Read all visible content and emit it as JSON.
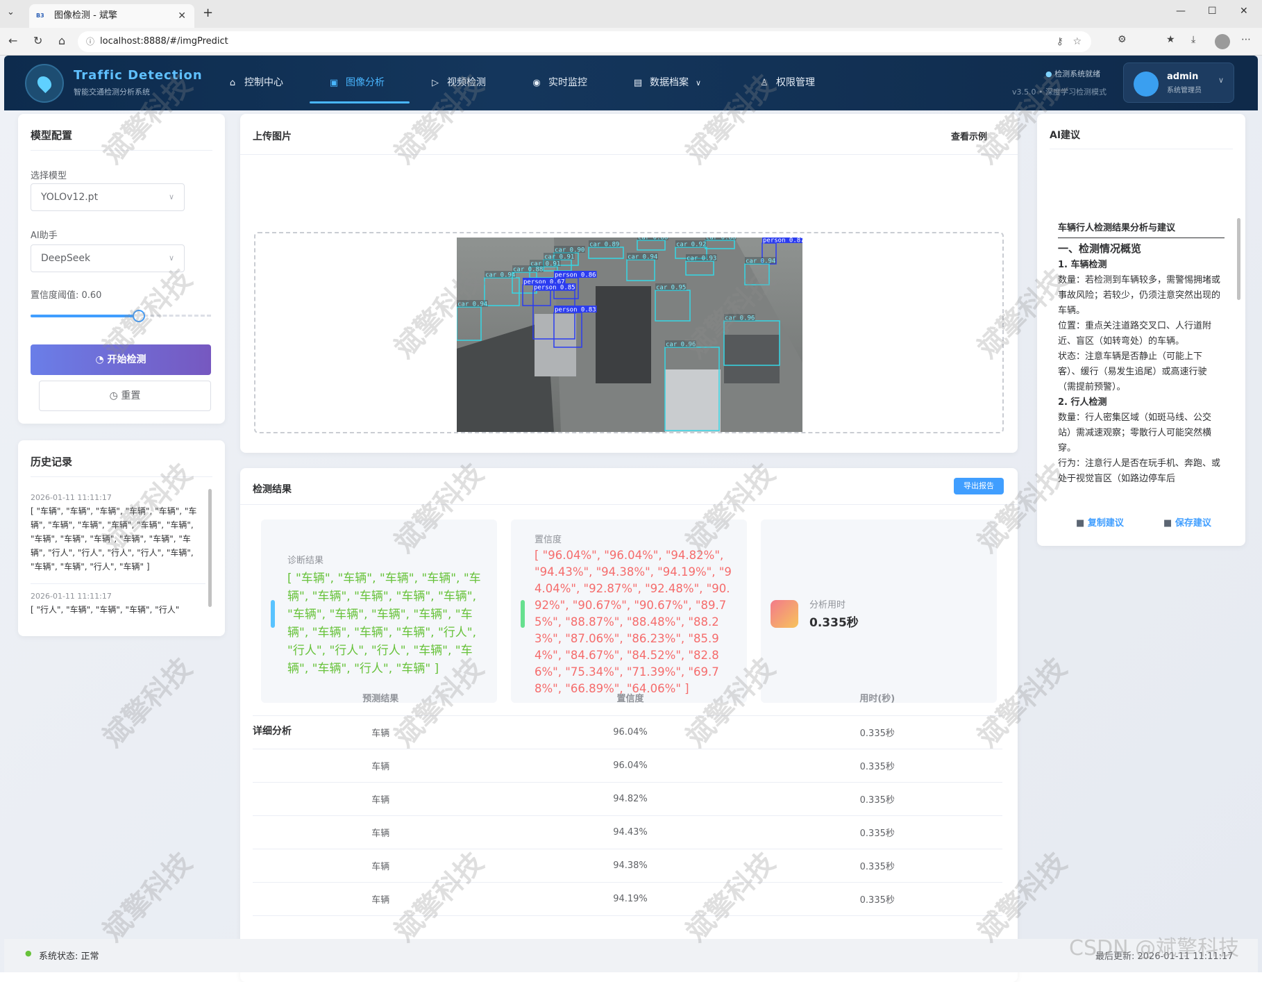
{
  "browser": {
    "tab_title": "图像检测 - 斌擎",
    "tab_favicon": "B3",
    "url": "localhost:8888/#/imgPredict"
  },
  "header": {
    "brand": "Traffic Detection",
    "brand_sub": "智能交通检测分析系统",
    "nav": [
      {
        "label": "控制中心",
        "icon": "home-icon"
      },
      {
        "label": "图像分析",
        "icon": "image-icon"
      },
      {
        "label": "视频检测",
        "icon": "play-icon"
      },
      {
        "label": "实时监控",
        "icon": "camera-icon"
      },
      {
        "label": "数据档案",
        "icon": "document-icon"
      },
      {
        "label": "权限管理",
        "icon": "user-icon"
      }
    ],
    "system_status": "检测系统就绪",
    "version": "v3.5.0 • 深度学习检测模式",
    "user": {
      "name": "admin",
      "role": "系统管理员"
    }
  },
  "model_config": {
    "title": "模型配置",
    "model_label": "选择模型",
    "model_value": "YOLOv12.pt",
    "assistant_label": "AI助手",
    "assistant_value": "DeepSeek",
    "threshold_label": "置信度阈值: 0.60",
    "threshold_value": 0.6,
    "start_button": "开始检测",
    "reset_button": "重置"
  },
  "history": {
    "title": "历史记录",
    "items": [
      {
        "time": "2026-01-11 11:11:17",
        "text": "[ \"车辆\", \"车辆\", \"车辆\", \"车辆\", \"车辆\", \"车辆\", \"车辆\", \"车辆\", \"车辆\", \"车辆\", \"车辆\", \"车辆\", \"车辆\", \"车辆\", \"车辆\", \"车辆\", \"车辆\", \"行人\", \"行人\", \"行人\", \"行人\", \"车辆\", \"车辆\", \"车辆\", \"行人\", \"车辆\" ]"
      },
      {
        "time": "2026-01-11 11:11:17",
        "text": "[ \"行人\", \"车辆\", \"车辆\", \"车辆\", \"行人\""
      }
    ]
  },
  "upload": {
    "title": "上传图片",
    "example_link": "查看示例",
    "detections": [
      "car 0.89",
      "car 0.86",
      "car 0.88",
      "car 0.92",
      "person 0.87",
      "car 0.90",
      "car 0.91",
      "car 0.91",
      "car 0.94",
      "car 0.93",
      "car 0.88",
      "car 0.94",
      "person 0.67",
      "person 0.86",
      "person 0.85",
      "car 0.95",
      "car 0.94",
      "person 0.83",
      "car 0.96",
      "car 0.96",
      "car 0.94"
    ]
  },
  "results": {
    "title": "检测结果",
    "export_button": "导出报告",
    "diagnosis_title": "诊断结果",
    "diagnosis_text": "[ \"车辆\", \"车辆\", \"车辆\", \"车辆\", \"车辆\", \"车辆\", \"车辆\", \"车辆\", \"车辆\", \"车辆\", \"车辆\", \"车辆\", \"车辆\", \"车辆\", \"车辆\", \"车辆\", \"车辆\", \"行人\", \"行人\", \"行人\", \"行人\", \"车辆\", \"车辆\", \"车辆\", \"行人\", \"车辆\" ]",
    "confidence_title": "置信度",
    "confidence_text": "[ \"96.04%\", \"96.04%\", \"94.82%\", \"94.43%\", \"94.38%\", \"94.19%\", \"94.04%\", \"92.87%\", \"92.48%\", \"90.92%\", \"90.67%\", \"90.67%\", \"89.75%\", \"88.87%\", \"88.48%\", \"88.23%\", \"87.06%\", \"86.23%\", \"85.94%\", \"84.67%\", \"84.52%\", \"82.86%\", \"75.34%\", \"71.39%\", \"69.78%\", \"66.89%\", \"64.06%\" ]",
    "time_title": "分析用时",
    "time_value": "0.335秒"
  },
  "detail": {
    "title": "详细分析",
    "columns": [
      "预测结果",
      "置信度",
      "用时(秒)"
    ],
    "rows": [
      [
        "车辆",
        "96.04%",
        "0.335秒"
      ],
      [
        "车辆",
        "96.04%",
        "0.335秒"
      ],
      [
        "车辆",
        "94.82%",
        "0.335秒"
      ],
      [
        "车辆",
        "94.43%",
        "0.335秒"
      ],
      [
        "车辆",
        "94.38%",
        "0.335秒"
      ],
      [
        "车辆",
        "94.19%",
        "0.335秒"
      ]
    ]
  },
  "ai": {
    "title": "AI建议",
    "heading": "车辆行人检测结果分析与建议",
    "section1": "一、检测情况概览",
    "sub1": "1. 车辆检测",
    "p1": "数量：若检测到车辆较多，需警惕拥堵或事故风险；若较少，仍须注意突然出现的车辆。",
    "p2": "位置：重点关注道路交叉口、人行道附近、盲区（如转弯处）的车辆。",
    "p3": "状态：注意车辆是否静止（可能上下客）、缓行（易发生追尾）或高速行驶（需提前预警）。",
    "sub2": "2. 行人检测",
    "p4": "数量：行人密集区域（如斑马线、公交站）需减速观察；零散行人可能突然横穿。",
    "p5": "行为：注意行人是否在玩手机、奔跑、或处于视觉盲区（如路边停车后",
    "copy_button": "复制建议",
    "save_button": "保存建议"
  },
  "footer": {
    "status": "系统状态: 正常",
    "last_update": "最后更新: 2026-01-11 11:11:17"
  },
  "watermarks": {
    "text": "斌擎科技",
    "csdn": "CSDN @斌擎科技"
  },
  "colors": {
    "accent": "#49b6ff",
    "diagnosis": "#67c23a",
    "confidence": "#f56c6c",
    "primary": "#7658c0"
  }
}
